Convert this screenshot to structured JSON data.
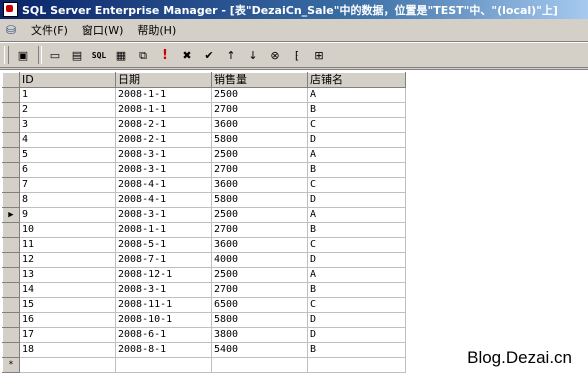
{
  "window": {
    "title": "SQL Server Enterprise Manager - [表\"DezaiCn_Sale\"中的数据，位置是\"TEST\"中、\"(local)\"上]"
  },
  "menu": {
    "items": [
      "文件(F)",
      "窗口(W)",
      "帮助(H)"
    ]
  },
  "toolbar": {
    "buttons": [
      {
        "name": "properties-icon",
        "glyph": "▣"
      },
      {
        "name": "show-diagram-pane-icon",
        "glyph": "▭"
      },
      {
        "name": "show-grid-pane-icon",
        "glyph": "▤"
      },
      {
        "name": "show-sql-pane-icon",
        "glyph": "SQL"
      },
      {
        "name": "show-results-pane-icon",
        "glyph": "▦"
      },
      {
        "name": "change-query-type-icon",
        "glyph": "⧉"
      },
      {
        "name": "run-icon",
        "glyph": "!"
      },
      {
        "name": "cancel-query-icon",
        "glyph": "✖"
      },
      {
        "name": "verify-sql-icon",
        "glyph": "✔"
      },
      {
        "name": "sort-ascending-icon",
        "glyph": "↑"
      },
      {
        "name": "sort-descending-icon",
        "glyph": "↓"
      },
      {
        "name": "remove-filter-icon",
        "glyph": "⊗"
      },
      {
        "name": "group-by-icon",
        "glyph": "⁅"
      },
      {
        "name": "add-table-icon",
        "glyph": "⊞"
      }
    ]
  },
  "grid": {
    "columns": [
      "ID",
      "日期",
      "销售量",
      "店铺名"
    ],
    "current_row": 8,
    "new_row_marker": "*",
    "current_row_marker": "▶",
    "rows": [
      [
        "1",
        "2008-1-1",
        "2500",
        "A"
      ],
      [
        "2",
        "2008-1-1",
        "2700",
        "B"
      ],
      [
        "3",
        "2008-2-1",
        "3600",
        "C"
      ],
      [
        "4",
        "2008-2-1",
        "5800",
        "D"
      ],
      [
        "5",
        "2008-3-1",
        "2500",
        "A"
      ],
      [
        "6",
        "2008-3-1",
        "2700",
        "B"
      ],
      [
        "7",
        "2008-4-1",
        "3600",
        "C"
      ],
      [
        "8",
        "2008-4-1",
        "5800",
        "D"
      ],
      [
        "9",
        "2008-3-1",
        "2500",
        "A"
      ],
      [
        "10",
        "2008-1-1",
        "2700",
        "B"
      ],
      [
        "11",
        "2008-5-1",
        "3600",
        "C"
      ],
      [
        "12",
        "2008-7-1",
        "4000",
        "D"
      ],
      [
        "13",
        "2008-12-1",
        "2500",
        "A"
      ],
      [
        "14",
        "2008-3-1",
        "2700",
        "B"
      ],
      [
        "15",
        "2008-11-1",
        "6500",
        "C"
      ],
      [
        "16",
        "2008-10-1",
        "5800",
        "D"
      ],
      [
        "17",
        "2008-6-1",
        "3800",
        "D"
      ],
      [
        "18",
        "2008-8-1",
        "5400",
        "B"
      ]
    ]
  },
  "watermark": "Blog.Dezai.cn"
}
